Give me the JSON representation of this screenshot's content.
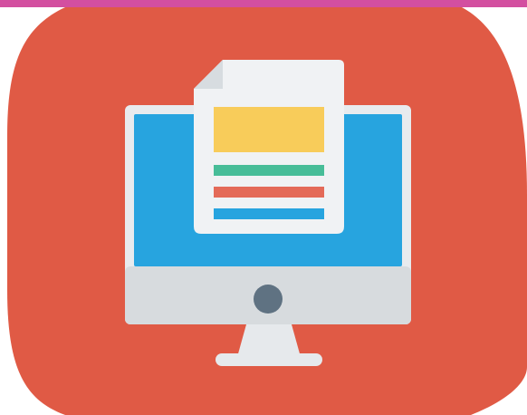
{
  "image": {
    "icon": "computer-document-icon",
    "colors": {
      "top_strip": "#d34fa0",
      "background_shape": "#e05a45",
      "monitor_frame": "#e8ebee",
      "monitor_screen": "#27a4df",
      "monitor_bezel": "#d7dbde",
      "power_button": "#5f7282",
      "stand": "#e6e9ec",
      "document_page": "#f0f2f4",
      "document_fold": "#d7dce0",
      "document_header_block": "#f8cc5a",
      "line_green": "#47bd98",
      "line_red": "#e46a58",
      "line_blue": "#27a4df"
    }
  }
}
